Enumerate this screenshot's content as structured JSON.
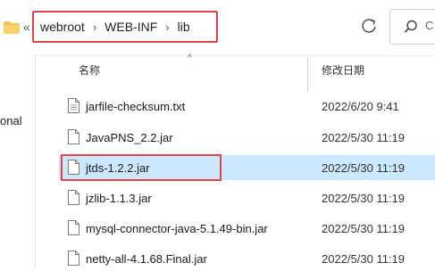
{
  "address": {
    "overflow": "«",
    "crumbs": [
      "webroot",
      "WEB-INF",
      "lib"
    ],
    "separator": "›",
    "search_label": "C"
  },
  "nav": {
    "visible_text": "onal"
  },
  "columns": {
    "name": "名称",
    "date": "修改日期",
    "sort_indicator": "^"
  },
  "files": [
    {
      "name": "jarfile-checksum.txt",
      "date": "2022/6/20 9:41",
      "type": "text"
    },
    {
      "name": "JavaPNS_2.2.jar",
      "date": "2022/5/30 11:19",
      "type": "jar"
    },
    {
      "name": "jtds-1.2.2.jar",
      "date": "2022/5/30 11:19",
      "type": "jar",
      "selected": true
    },
    {
      "name": "jzlib-1.1.3.jar",
      "date": "2022/5/30 11:19",
      "type": "jar"
    },
    {
      "name": "mysql-connector-java-5.1.49-bin.jar",
      "date": "2022/5/30 11:19",
      "type": "jar"
    },
    {
      "name": "netty-all-4.1.68.Final.jar",
      "date": "2022/5/30 11:19",
      "type": "jar"
    }
  ],
  "colors": {
    "highlight_border": "#e0434a",
    "selection_bg": "#cce8ff",
    "folder": "#f2c14e"
  }
}
